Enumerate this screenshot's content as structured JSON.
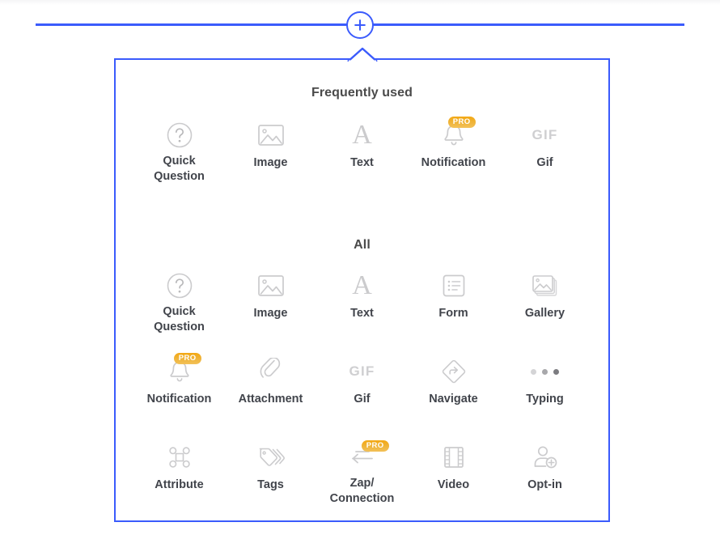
{
  "toolbar": {
    "add_button_label": "+",
    "add_button_icon": "plus-circle-icon"
  },
  "panel": {
    "sections": [
      {
        "id": "frequently-used",
        "title": "Frequently used",
        "items": [
          {
            "label": "Quick\nQuestion",
            "label_line1": "Quick",
            "label_line2": "Question",
            "icon": "question-circle-icon",
            "pro": false
          },
          {
            "label": "Image",
            "icon": "image-icon",
            "pro": false
          },
          {
            "label": "Text",
            "icon": "text-a-icon",
            "pro": false
          },
          {
            "label": "Notification",
            "icon": "bell-icon",
            "pro": true,
            "badge": "PRO"
          },
          {
            "label": "Gif",
            "icon": "gif-icon",
            "pro": false
          }
        ]
      },
      {
        "id": "all",
        "title": "All",
        "items": [
          {
            "label_line1": "Quick",
            "label_line2": "Question",
            "icon": "question-circle-icon",
            "pro": false
          },
          {
            "label": "Image",
            "icon": "image-icon",
            "pro": false
          },
          {
            "label": "Text",
            "icon": "text-a-icon",
            "pro": false
          },
          {
            "label": "Form",
            "icon": "form-list-icon",
            "pro": false
          },
          {
            "label": "Gallery",
            "icon": "gallery-icon",
            "pro": false
          },
          {
            "label": "Notification",
            "icon": "bell-icon",
            "pro": true,
            "badge": "PRO"
          },
          {
            "label": "Attachment",
            "icon": "paperclip-icon",
            "pro": false
          },
          {
            "label": "Gif",
            "icon": "gif-icon",
            "pro": false
          },
          {
            "label": "Navigate",
            "icon": "navigate-diamond-arrow-icon",
            "pro": false
          },
          {
            "label": "Typing",
            "icon": "typing-dots-icon",
            "pro": false
          },
          {
            "label": "Attribute",
            "icon": "command-icon",
            "pro": false
          },
          {
            "label": "Tags",
            "icon": "tags-icon",
            "pro": false
          },
          {
            "label_line1": "Zap/",
            "label_line2": "Connection",
            "icon": "zap-connection-arrow-icon",
            "pro": true,
            "badge": "PRO"
          },
          {
            "label": "Video",
            "icon": "film-strip-icon",
            "pro": false
          },
          {
            "label": "Opt-in",
            "icon": "person-add-icon",
            "pro": false
          }
        ]
      }
    ]
  },
  "colors": {
    "accent_blue": "#3b5bfc",
    "pro_badge_orange": "#f3a712",
    "icon_gray": "#cbcbcd",
    "label_gray": "#41444b"
  }
}
